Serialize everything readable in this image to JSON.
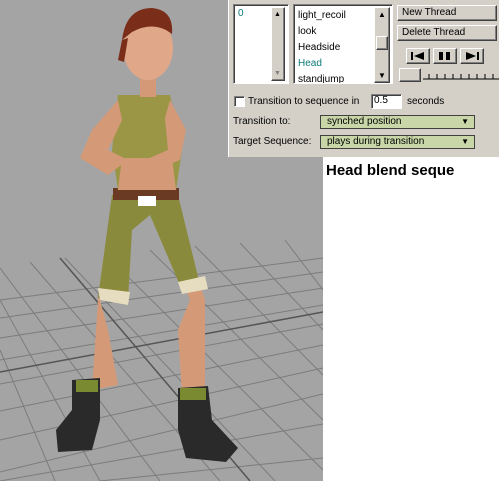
{
  "thread_list": {
    "items": [
      "0"
    ]
  },
  "sequence_list": {
    "items": [
      "light_recoil",
      "look",
      "Headside",
      "Head",
      "standjump"
    ],
    "selected": "Head"
  },
  "buttons": {
    "new_thread": "New Thread",
    "delete_thread": "Delete Thread"
  },
  "transition": {
    "checkbox_label": "Transition to sequence in",
    "checked": false,
    "duration_value": "0.5",
    "duration_unit": "seconds",
    "transition_to_label": "Transition to:",
    "transition_to_value": "synched position",
    "target_sequence_label": "Target Sequence:",
    "target_sequence_value": "plays during transition"
  },
  "caption": "Head blend seque",
  "colors": {
    "panel_bg": "#d4d0c8",
    "dropdown_bg": "#c8d6a8",
    "selected_text": "#0a7a78",
    "viewport_bg": "#a4a4a4"
  }
}
